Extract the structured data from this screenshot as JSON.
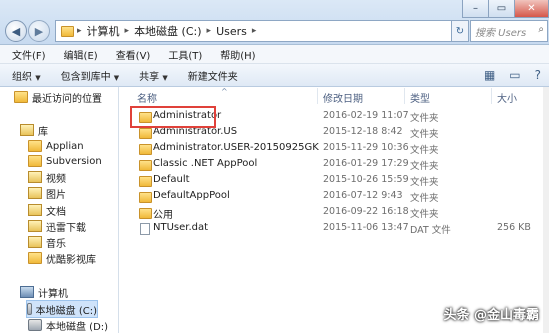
{
  "window": {
    "minimize": "–",
    "maximize": "▭",
    "close": "✕"
  },
  "address": {
    "back": "◀",
    "forward": "▶",
    "path": [
      "计算机",
      "本地磁盘 (C:)",
      "Users"
    ],
    "search_placeholder": "搜索 Users"
  },
  "menu": [
    "文件(F)",
    "编辑(E)",
    "查看(V)",
    "工具(T)",
    "帮助(H)"
  ],
  "toolbar": [
    "组织",
    "包含到库中",
    "共享",
    "新建文件夹"
  ],
  "nav": {
    "recent": "最近访问的位置",
    "library": "库",
    "library_items": [
      "Applian",
      "Subversion",
      "视频",
      "图片",
      "文档",
      "迅雷下载",
      "音乐",
      "优酷影视库"
    ],
    "computer": "计算机",
    "drives": [
      "本地磁盘 (C:)",
      "本地磁盘 (D:)"
    ]
  },
  "columns": {
    "name": "名称",
    "date": "修改日期",
    "type": "类型",
    "size": "大小"
  },
  "rows": [
    {
      "name": "Administrator",
      "date": "2016-02-19 11:07",
      "type": "文件夹",
      "size": "",
      "kind": "folder"
    },
    {
      "name": "Administrator.US",
      "date": "2015-12-18 8:42",
      "type": "文件夹",
      "size": "",
      "kind": "folder"
    },
    {
      "name": "Administrator.USER-20150925GK",
      "date": "2015-11-29 10:36",
      "type": "文件夹",
      "size": "",
      "kind": "folder"
    },
    {
      "name": "Classic .NET AppPool",
      "date": "2016-01-29 17:29",
      "type": "文件夹",
      "size": "",
      "kind": "folder"
    },
    {
      "name": "Default",
      "date": "2015-10-26 15:59",
      "type": "文件夹",
      "size": "",
      "kind": "folder"
    },
    {
      "name": "DefaultAppPool",
      "date": "2016-07-12 9:43",
      "type": "文件夹",
      "size": "",
      "kind": "folder"
    },
    {
      "name": "公用",
      "date": "2016-09-22 16:18",
      "type": "文件夹",
      "size": "",
      "kind": "folder"
    },
    {
      "name": "NTUser.dat",
      "date": "2015-11-06 13:47",
      "type": "DAT 文件",
      "size": "256 KB",
      "kind": "file"
    }
  ],
  "watermark": "头条 @金山毒霸",
  "colors": {
    "highlight": "#e0413a",
    "folder": "#f0b93a",
    "selected": "#cfe3fa"
  }
}
